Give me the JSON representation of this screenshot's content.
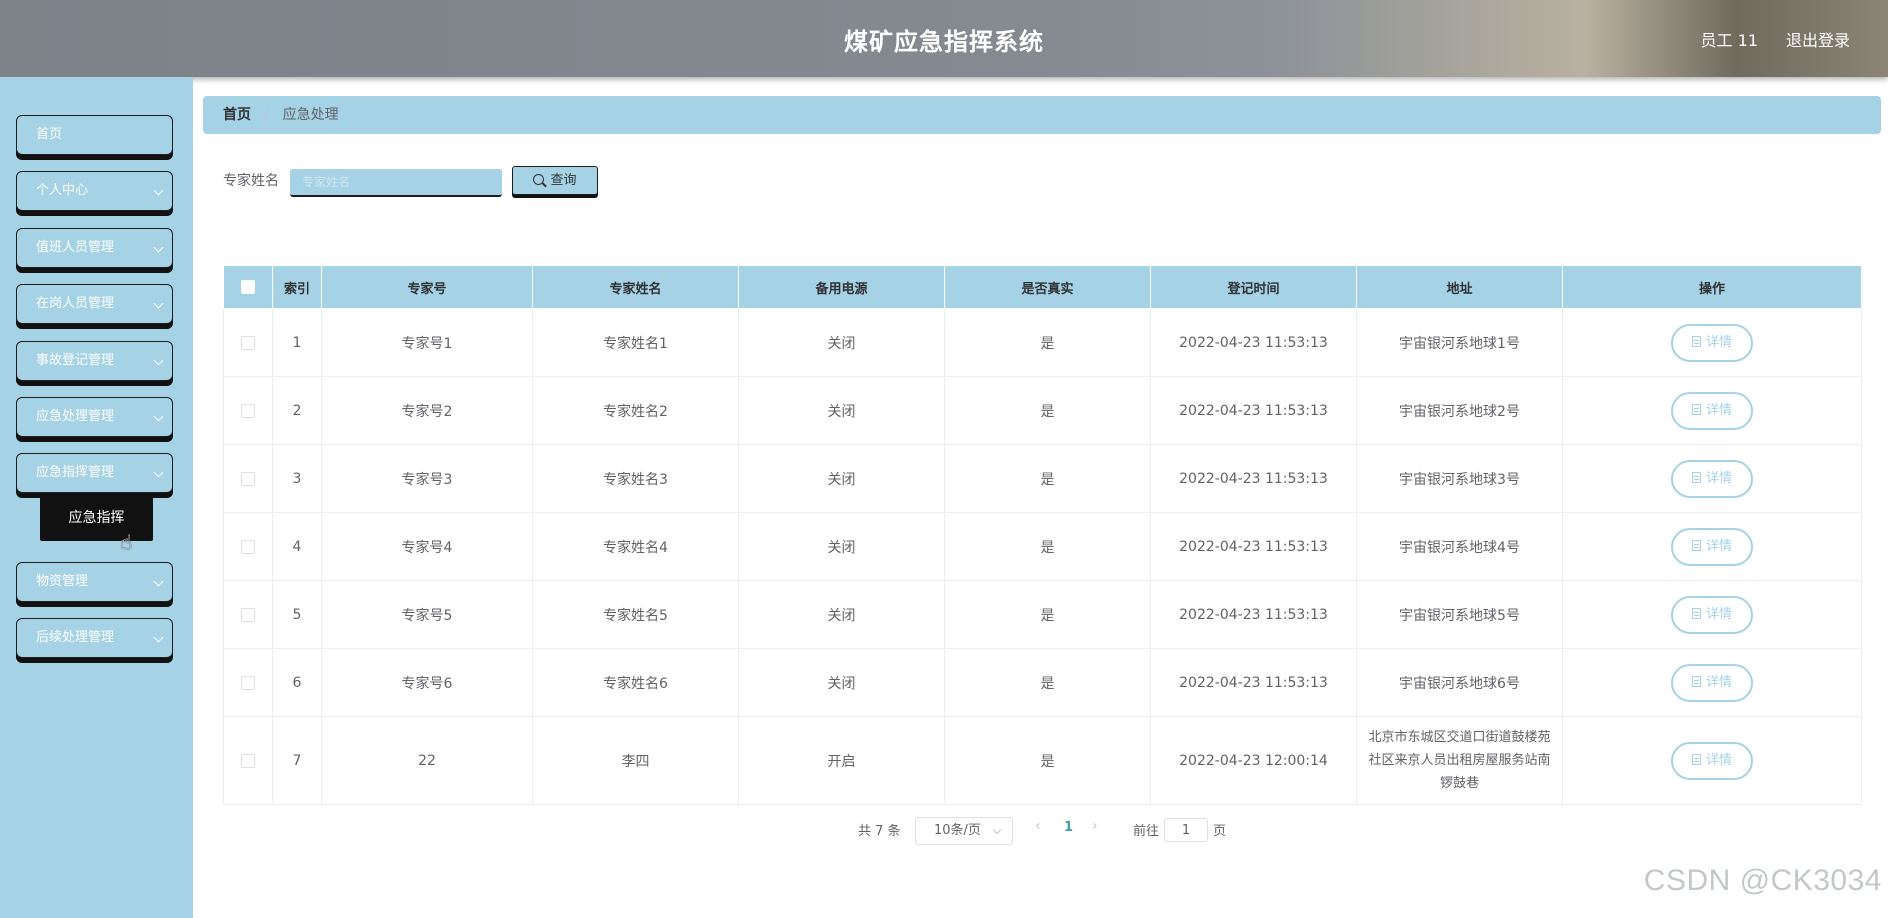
{
  "header": {
    "title": "煤矿应急指挥系统",
    "user": "员工 11",
    "logout": "退出登录"
  },
  "sidebar": {
    "items": [
      {
        "label": "首页",
        "has_arrow": false
      },
      {
        "label": "个人中心",
        "has_arrow": true
      },
      {
        "label": "值班人员管理",
        "has_arrow": true
      },
      {
        "label": "在岗人员管理",
        "has_arrow": true
      },
      {
        "label": "事故登记管理",
        "has_arrow": true
      },
      {
        "label": "应急处理管理",
        "has_arrow": true
      },
      {
        "label": "应急指挥管理",
        "has_arrow": true
      },
      {
        "label": "物资管理",
        "has_arrow": true
      },
      {
        "label": "后续处理管理",
        "has_arrow": true
      }
    ],
    "submenu": {
      "label": "应急指挥"
    }
  },
  "breadcrumb": {
    "home": "首页",
    "separator": "/",
    "current": "应急处理"
  },
  "search": {
    "label": "专家姓名",
    "placeholder": "专家姓名",
    "button_label": "查询"
  },
  "table": {
    "headers": [
      "索引",
      "专家号",
      "专家姓名",
      "备用电源",
      "是否真实",
      "登记时间",
      "地址",
      "操作"
    ],
    "rows": [
      {
        "index": "1",
        "expert_no": "专家号1",
        "expert_name": "专家姓名1",
        "backup_power": "关闭",
        "is_real": "是",
        "time": "2022-04-23 11:53:13",
        "address": "宇宙银河系地球1号"
      },
      {
        "index": "2",
        "expert_no": "专家号2",
        "expert_name": "专家姓名2",
        "backup_power": "关闭",
        "is_real": "是",
        "time": "2022-04-23 11:53:13",
        "address": "宇宙银河系地球2号"
      },
      {
        "index": "3",
        "expert_no": "专家号3",
        "expert_name": "专家姓名3",
        "backup_power": "关闭",
        "is_real": "是",
        "time": "2022-04-23 11:53:13",
        "address": "宇宙银河系地球3号"
      },
      {
        "index": "4",
        "expert_no": "专家号4",
        "expert_name": "专家姓名4",
        "backup_power": "关闭",
        "is_real": "是",
        "time": "2022-04-23 11:53:13",
        "address": "宇宙银河系地球4号"
      },
      {
        "index": "5",
        "expert_no": "专家号5",
        "expert_name": "专家姓名5",
        "backup_power": "关闭",
        "is_real": "是",
        "time": "2022-04-23 11:53:13",
        "address": "宇宙银河系地球5号"
      },
      {
        "index": "6",
        "expert_no": "专家号6",
        "expert_name": "专家姓名6",
        "backup_power": "关闭",
        "is_real": "是",
        "time": "2022-04-23 11:53:13",
        "address": "宇宙银河系地球6号"
      },
      {
        "index": "7",
        "expert_no": "22",
        "expert_name": "李四",
        "backup_power": "开启",
        "is_real": "是",
        "time": "2022-04-23 12:00:14",
        "address": "北京市东城区交道口街道鼓楼苑社区来京人员出租房屋服务站南锣鼓巷"
      }
    ],
    "action_label": "详情"
  },
  "pagination": {
    "total": "共 7 条",
    "page_size": "10条/页",
    "prev": "‹",
    "current_page": "1",
    "next": "›",
    "goto_label": "前往",
    "goto_value": "1",
    "page_suffix": "页"
  },
  "watermark": "CSDN @CK3034",
  "colors": {
    "accent": "#a6d2e6",
    "active_page": "#409eaa"
  },
  "icons": {
    "search": "search-icon",
    "chevron": "chevron-down-icon",
    "detail": "document-icon",
    "cursor": "hand-pointer-icon"
  }
}
